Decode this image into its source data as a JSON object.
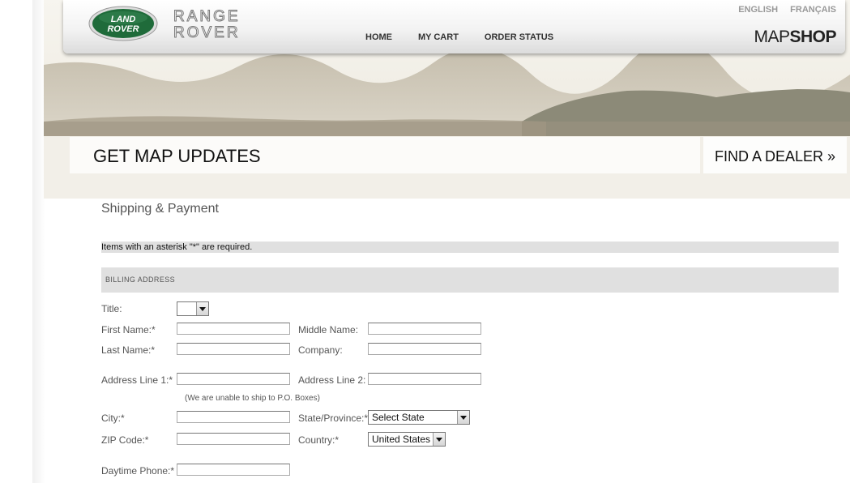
{
  "header": {
    "brand_small": "LAND ROVER",
    "brand_line1": "LAND",
    "brand_line2": "ROVER",
    "brand_wordmark1": "RANGE",
    "brand_wordmark2": "ROVER",
    "nav": [
      "HOME",
      "MY CART",
      "ORDER STATUS"
    ],
    "languages": [
      "ENGLISH",
      "FRANÇAIS"
    ],
    "shop_prefix": "MAP",
    "shop_suffix": "SHOP"
  },
  "hero": {
    "title": "GET MAP UPDATES",
    "dealer_link": "FIND A DEALER »"
  },
  "form": {
    "page_title": "Shipping & Payment",
    "required_note": "Items with an asterisk \"*\" are required.",
    "section_title": "BILLING ADDRESS",
    "title_label": "Title:",
    "first_name_label": "First Name:*",
    "middle_name_label": "Middle Name:",
    "last_name_label": "Last Name:*",
    "company_label": "Company:",
    "address1_label": "Address Line 1:*",
    "address2_label": "Address Line 2:",
    "po_box_note": "(We are unable to ship to P.O. Boxes)",
    "city_label": "City:*",
    "state_label": "State/Province:*",
    "state_value": "Select State",
    "zip_label": "ZIP Code:*",
    "country_label": "Country:*",
    "country_value": "United States",
    "phone_label": "Daytime Phone:*"
  },
  "colors": {
    "logo_green": "#1f6b3a",
    "section_gray": "#e0e0e0",
    "label_gray": "#555555"
  }
}
